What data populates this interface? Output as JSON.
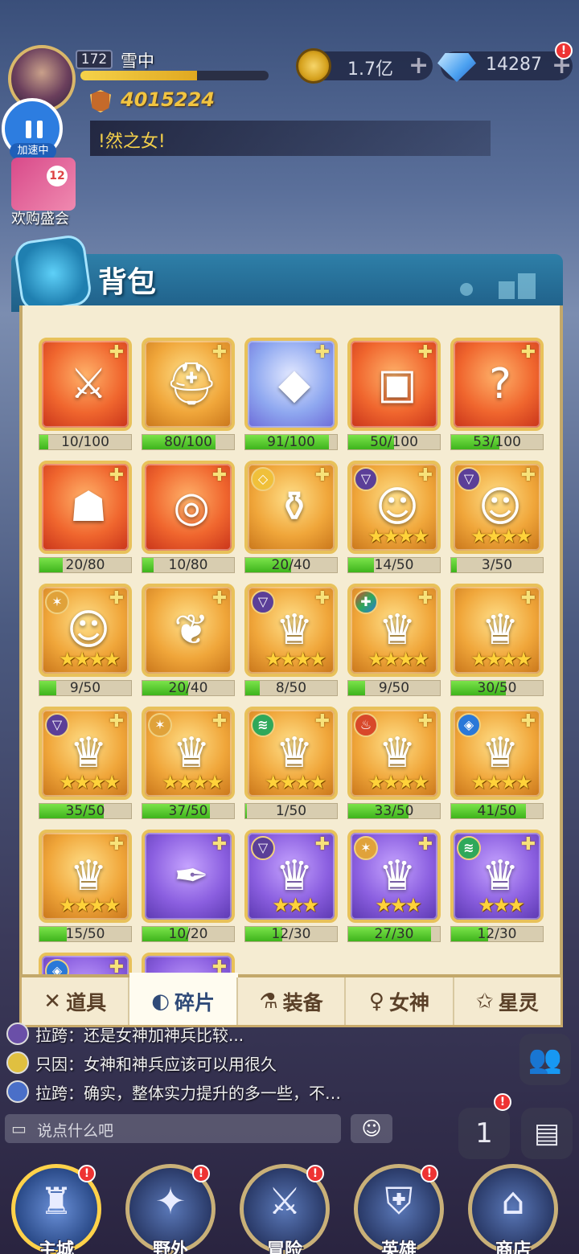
{
  "player": {
    "level": "172",
    "name": "雪中",
    "exp_fraction": 0.62,
    "power": "4015224"
  },
  "resources": {
    "gold": "1.7亿",
    "gems": "14287",
    "plus": "+",
    "alert": "!"
  },
  "speed_label": "加速中",
  "marquee_text": "!然之女!",
  "event": {
    "label": "欢购盛会",
    "badge": "12"
  },
  "panel": {
    "title": "背包",
    "puzzle_icon": "puzzle-piece-icon"
  },
  "items": [
    {
      "name": "spear-fragment",
      "frame": "red",
      "icon": "⚔",
      "progress": "10/100",
      "ratio": 0.1,
      "stars": "",
      "faction": ""
    },
    {
      "name": "helmet-fragment",
      "frame": "gold",
      "icon": "⛑",
      "progress": "80/100",
      "ratio": 0.8,
      "stars": "",
      "faction": ""
    },
    {
      "name": "crystal-fragment",
      "frame": "blue",
      "icon": "◆",
      "progress": "91/100",
      "ratio": 0.91,
      "stars": "",
      "faction": ""
    },
    {
      "name": "chest-fragment",
      "frame": "red",
      "icon": "▣",
      "progress": "50/100",
      "ratio": 0.5,
      "stars": "",
      "faction": ""
    },
    {
      "name": "mystery-fragment",
      "frame": "red",
      "icon": "?",
      "progress": "53/100",
      "ratio": 0.53,
      "stars": "",
      "faction": ""
    },
    {
      "name": "mask-fragment",
      "frame": "red",
      "icon": "☗",
      "progress": "20/80",
      "ratio": 0.25,
      "stars": "",
      "faction": ""
    },
    {
      "name": "ring-fragment",
      "frame": "red",
      "icon": "◎",
      "progress": "10/80",
      "ratio": 0.125,
      "stars": "",
      "faction": ""
    },
    {
      "name": "censer-fragment",
      "frame": "gold",
      "icon": "⚱",
      "progress": "20/40",
      "ratio": 0.5,
      "stars": "",
      "faction": "diamond"
    },
    {
      "name": "hero-silver-fragment",
      "frame": "gold",
      "icon": "☺",
      "progress": "14/50",
      "ratio": 0.28,
      "stars": "★★★★",
      "faction": "dark"
    },
    {
      "name": "hero-red-fragment",
      "frame": "gold",
      "icon": "☺",
      "progress": "3/50",
      "ratio": 0.06,
      "stars": "★★★★",
      "faction": "dark"
    },
    {
      "name": "hero-dark-fragment",
      "frame": "gold",
      "icon": "☺",
      "progress": "9/50",
      "ratio": 0.18,
      "stars": "★★★★",
      "faction": "light"
    },
    {
      "name": "wing-fragment",
      "frame": "gold",
      "icon": "❦",
      "progress": "20/40",
      "ratio": 0.5,
      "stars": "",
      "faction": ""
    },
    {
      "name": "mask-dark-4star",
      "frame": "gold",
      "icon": "♛",
      "progress": "8/50",
      "ratio": 0.16,
      "stars": "★★★★",
      "faction": "dark"
    },
    {
      "name": "mask-multi-4star",
      "frame": "gold",
      "icon": "♛",
      "progress": "9/50",
      "ratio": 0.18,
      "stars": "★★★★",
      "faction": "multi"
    },
    {
      "name": "mask-plain-4star",
      "frame": "gold",
      "icon": "♛",
      "progress": "30/50",
      "ratio": 0.6,
      "stars": "★★★★",
      "faction": ""
    },
    {
      "name": "crown-dark-4star",
      "frame": "gold",
      "icon": "♛",
      "progress": "35/50",
      "ratio": 0.7,
      "stars": "★★★★",
      "faction": "dark"
    },
    {
      "name": "crown-light-4star",
      "frame": "gold",
      "icon": "♛",
      "progress": "37/50",
      "ratio": 0.74,
      "stars": "★★★★",
      "faction": "light"
    },
    {
      "name": "crown-wind-4star",
      "frame": "gold",
      "icon": "♛",
      "progress": "1/50",
      "ratio": 0.02,
      "stars": "★★★★",
      "faction": "wind"
    },
    {
      "name": "crown-fire-4star",
      "frame": "gold",
      "icon": "♛",
      "progress": "33/50",
      "ratio": 0.66,
      "stars": "★★★★",
      "faction": "fire"
    },
    {
      "name": "crown-water-4star",
      "frame": "gold",
      "icon": "♛",
      "progress": "41/50",
      "ratio": 0.82,
      "stars": "★★★★",
      "faction": "water"
    },
    {
      "name": "crown-plain-4star",
      "frame": "gold",
      "icon": "♛",
      "progress": "15/50",
      "ratio": 0.3,
      "stars": "★★★★",
      "faction": ""
    },
    {
      "name": "quill-fragment",
      "frame": "purple",
      "icon": "✒",
      "progress": "10/20",
      "ratio": 0.5,
      "stars": "",
      "faction": ""
    },
    {
      "name": "crown-dark-3star",
      "frame": "purple",
      "icon": "♛",
      "progress": "12/30",
      "ratio": 0.4,
      "stars": "★★★",
      "faction": "dark"
    },
    {
      "name": "crown-light-3star",
      "frame": "purple",
      "icon": "♛",
      "progress": "27/30",
      "ratio": 0.9,
      "stars": "★★★",
      "faction": "light"
    },
    {
      "name": "crown-wind-3star",
      "frame": "purple",
      "icon": "♛",
      "progress": "12/30",
      "ratio": 0.4,
      "stars": "★★★",
      "faction": "wind"
    },
    {
      "name": "partial-water-3star",
      "frame": "purple",
      "icon": "",
      "progress": "",
      "ratio": 0,
      "stars": "",
      "faction": "water"
    },
    {
      "name": "partial-purple",
      "frame": "purple",
      "icon": "",
      "progress": "",
      "ratio": 0,
      "stars": "",
      "faction": ""
    }
  ],
  "tabs": [
    {
      "label": "道具",
      "icon": "✕",
      "icon_name": "items-icon",
      "active": false
    },
    {
      "label": "碎片",
      "icon": "◐",
      "icon_name": "fragments-icon",
      "active": true
    },
    {
      "label": "装备",
      "icon": "⚗",
      "icon_name": "equipment-icon",
      "active": false
    },
    {
      "label": "女神",
      "icon": "♀",
      "icon_name": "goddess-icon",
      "active": false
    },
    {
      "label": "星灵",
      "icon": "✩",
      "icon_name": "star-spirit-icon",
      "active": false
    }
  ],
  "chat": [
    {
      "text": "拉跨：还是女神加神兵比较..."
    },
    {
      "text": "只因：女神和神兵应该可以用很久"
    },
    {
      "text": "拉跨：确实，整体实力提升的多一些，不…"
    }
  ],
  "chat_input": {
    "placeholder": "说点什么吧",
    "emoji": "☺"
  },
  "nav": [
    {
      "label": "主城",
      "icon": "♜",
      "icon_name": "castle-icon",
      "active": true
    },
    {
      "label": "野外",
      "icon": "✦",
      "icon_name": "wild-icon",
      "active": false
    },
    {
      "label": "冒险",
      "icon": "⚔",
      "icon_name": "adventure-icon",
      "active": false
    },
    {
      "label": "英雄",
      "icon": "⛨",
      "icon_name": "hero-icon",
      "active": false
    },
    {
      "label": "商店",
      "icon": "⌂",
      "icon_name": "shop-icon",
      "active": false
    }
  ],
  "side_buttons": {
    "ranking": "1",
    "friends": "👥",
    "chat_hidden": "💬"
  },
  "colors": {
    "progress": "#4ec52a",
    "accent": "#2e7fa8",
    "gold": "#f1c441"
  }
}
